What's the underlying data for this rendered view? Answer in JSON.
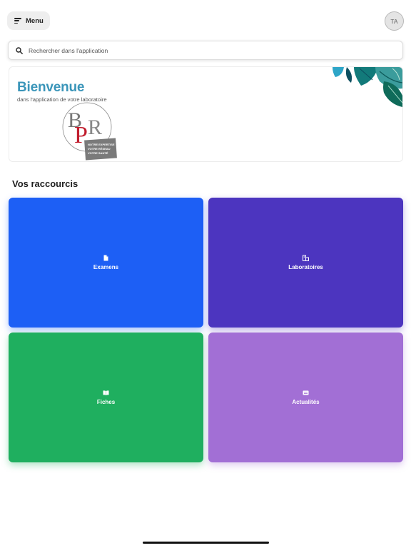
{
  "header": {
    "menu_label": "Menu",
    "avatar_initials": "TA"
  },
  "search": {
    "placeholder": "Rechercher dans l'application"
  },
  "welcome": {
    "title": "Bienvenue",
    "subtitle": "dans l'application de votre laboratoire",
    "logo_letters": "BPR",
    "logo_tagline": [
      "NOTRE EXPERTISE",
      "VOTRE RÉSEAU",
      "VOTRE SANTÉ"
    ]
  },
  "shortcuts": {
    "title": "Vos raccourcis",
    "items": [
      {
        "label": "Examens",
        "icon": "document-icon",
        "color": "#1d5ff5"
      },
      {
        "label": "Laboratoires",
        "icon": "building-icon",
        "color": "#4c35bf"
      },
      {
        "label": "Fiches",
        "icon": "book-icon",
        "color": "#1faf5f"
      },
      {
        "label": "Actualités",
        "icon": "newspaper-icon",
        "color": "#a26fd5"
      }
    ]
  },
  "colors": {
    "accent_title": "#3a95b9",
    "leaves_teal": "#127a7a",
    "leaves_dark": "#0c4f60",
    "logo_red": "#c11d2e",
    "logo_gray": "#777777"
  }
}
